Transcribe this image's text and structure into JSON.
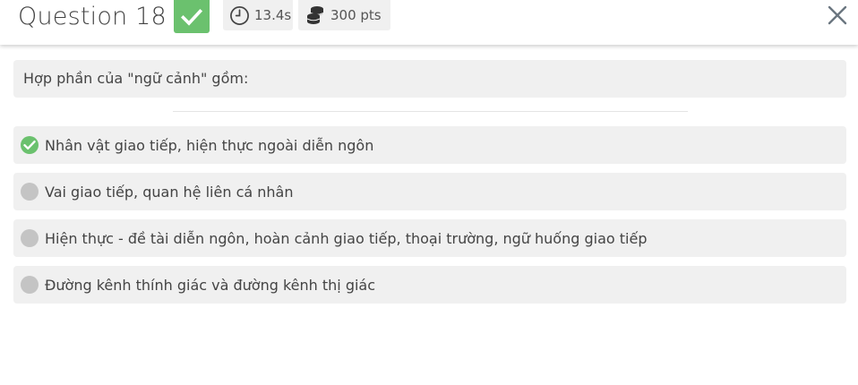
{
  "header": {
    "title": "Question 18",
    "status_icon": "check-icon",
    "status_color": "#6bc16e",
    "time": "13.4s",
    "time_icon": "clock-icon",
    "points": "300 pts",
    "points_icon": "coins-icon",
    "close_icon": "close-icon"
  },
  "question": {
    "text": "Hợp phần của \"ngữ cảnh\" gồm:"
  },
  "options": [
    {
      "text": "Nhân vật giao tiếp, hiện thực ngoài diễn ngôn",
      "selected": true
    },
    {
      "text": "Vai giao tiếp, quan hệ liên cá nhân",
      "selected": false
    },
    {
      "text": "Hiện thực - đề tài diễn ngôn, hoàn cảnh giao tiếp, thoại trường, ngữ huống giao tiếp",
      "selected": false
    },
    {
      "text": "Đường kênh thính giác và đường kênh thị giác",
      "selected": false
    }
  ],
  "colors": {
    "correct": "#6bc16e",
    "unselected": "#c4c4c4",
    "panel": "#f0f0f0"
  }
}
